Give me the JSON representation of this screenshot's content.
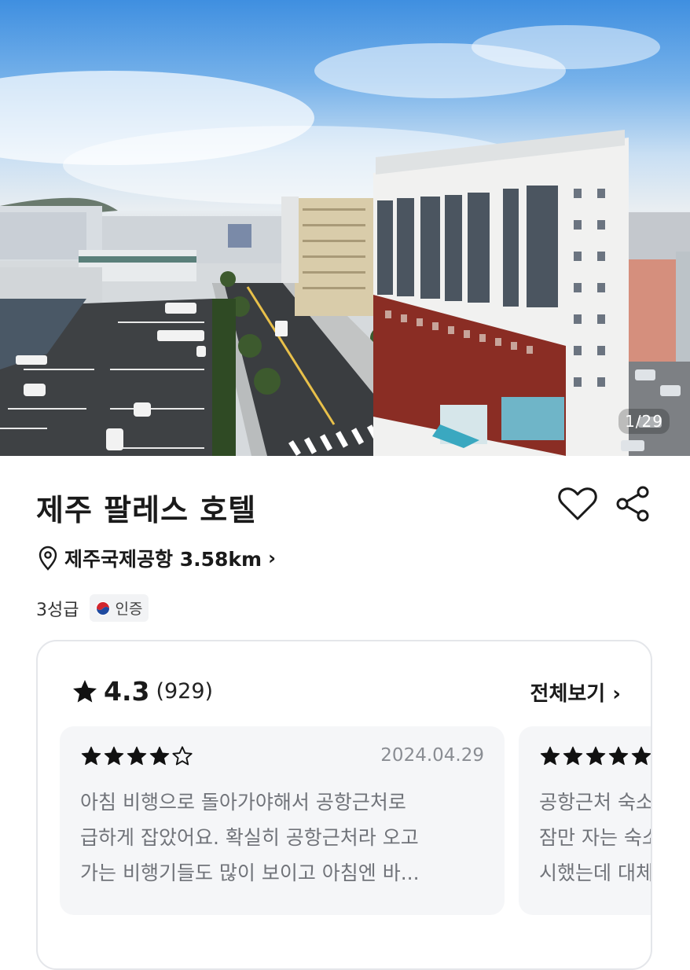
{
  "gallery": {
    "counter": "1/29"
  },
  "hotel": {
    "name": "제주 팔레스 호텔",
    "location": "제주국제공항 3.58km",
    "grade": "3성급",
    "certification": "인증"
  },
  "icons": {
    "like": "heart-outline-icon",
    "share": "share-icon",
    "location": "map-pin-icon",
    "rating": "star-icon"
  },
  "reviews": {
    "rating": "4.3",
    "count": "(929)",
    "see_all": "전체보기",
    "items": [
      {
        "stars": 4,
        "date": "2024.04.29",
        "lines": [
          "아침 비행으로 돌아가야해서 공항근처로",
          "급하게 잡았어요. 확실히 공항근처라 오고",
          "가는 비행기들도 많이 보이고 아침엔 바..."
        ]
      },
      {
        "stars": 5,
        "date": "",
        "lines": [
          "공항근처 숙소",
          "잠만 자는 숙소",
          "시했는데 대체"
        ]
      }
    ]
  },
  "colors": {
    "text": "#1a1a1a",
    "muted": "#8a8d93",
    "card_border": "#e4e6ea",
    "review_bg": "#f5f6f8"
  }
}
